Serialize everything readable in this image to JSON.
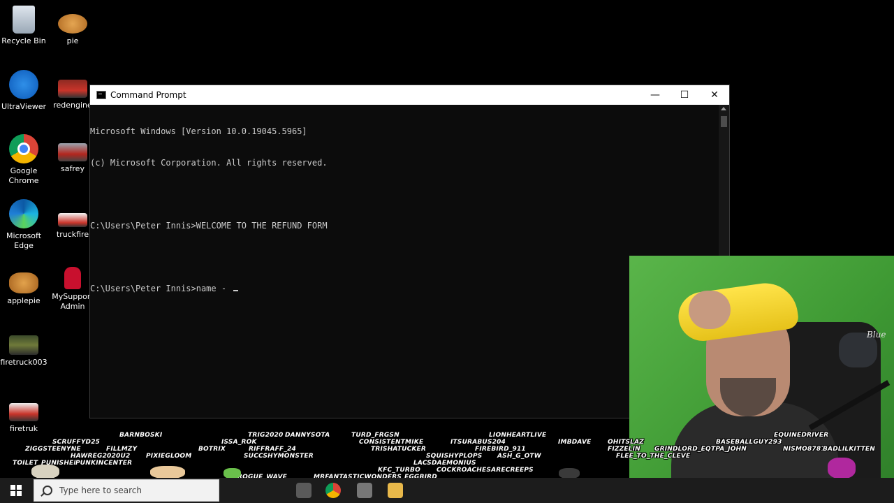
{
  "desktop": {
    "icons": [
      {
        "label": "Recycle Bin",
        "icon": "recycle-bin-icon"
      },
      {
        "label": "pie",
        "icon": "pie-icon"
      },
      {
        "label": "UltraViewer",
        "icon": "ultraviewer-icon"
      },
      {
        "label": "redengine",
        "icon": "firetruck-image-icon"
      },
      {
        "label": "Google Chrome",
        "icon": "chrome-icon"
      },
      {
        "label": "safrey",
        "icon": "firetruck-image-icon"
      },
      {
        "label": "Microsoft Edge",
        "icon": "edge-icon"
      },
      {
        "label": "truckfire",
        "icon": "firetruck-image-icon"
      },
      {
        "label": "applepie",
        "icon": "applepie-icon"
      },
      {
        "label": "MySupport Admin",
        "icon": "mysupport-admin-icon"
      },
      {
        "label": "firetruck003",
        "icon": "firetruck-image-icon"
      },
      {
        "label": "firetruk",
        "icon": "firetruck-image-icon"
      }
    ]
  },
  "cmd_window": {
    "title": "Command Prompt",
    "minimize": "—",
    "maximize": "☐",
    "close": "✕",
    "lines": [
      "Microsoft Windows [Version 10.0.19045.5965]",
      "(c) Microsoft Corporation. All rights reserved.",
      "",
      "C:\\Users\\Peter Innis>WELCOME TO THE REFUND FORM",
      "",
      "C:\\Users\\Peter Innis>name - "
    ]
  },
  "webcam": {
    "mic_brand": "Blue"
  },
  "chat_names": [
    "BARNBOSKI",
    "TRIG2020",
    "DANNYSOTA",
    "TURD_FRGSN",
    "LIONHEARTLIVE",
    "EQUINEDRIVER",
    "SCRUFFYD25",
    "ISSA_ROK",
    "CONSISTENTMIKE",
    "ITSURABUS204",
    "IMBDAVE",
    "OHITSLAZ",
    "BASEBALLGUY293",
    "ZIGGSTEENYNE",
    "FILLMZY",
    "BOTRIX",
    "RIFFRAFF_24",
    "TRISHATUCKER",
    "FIREBIRD_911",
    "FIZZELIN",
    "GRINDLORD_EQ",
    "TPA_JOHN",
    "NISMO8787",
    "BADLILKITTEN",
    "HAWREG2020U2",
    "PIXIEGLOOM",
    "SUCCSHYMONSTER",
    "SQUISHYPLOPS",
    "ASH_G_OTW",
    "FLEE_TO_THE_CLEVE",
    "TOILET_PUNISHER",
    "PUNKINCENTER",
    "LACSDAEMONIUS",
    "ROGUE_WAVE",
    "KFC_TURBO",
    "MRFANTASTICWONDERS",
    "EGGBIRD",
    "COCKROACHESARECREEPS"
  ],
  "taskbar": {
    "search_placeholder": "Type here to search",
    "pinned": [
      "task-view-icon",
      "chrome-icon",
      "camera-icon",
      "file-explorer-icon"
    ]
  }
}
